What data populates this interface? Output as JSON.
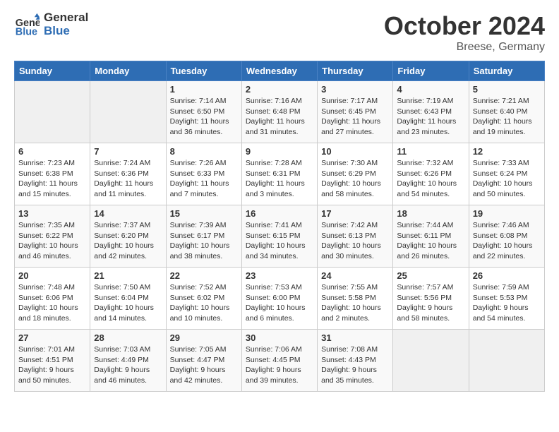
{
  "header": {
    "logo_general": "General",
    "logo_blue": "Blue",
    "month_title": "October 2024",
    "subtitle": "Breese, Germany"
  },
  "weekdays": [
    "Sunday",
    "Monday",
    "Tuesday",
    "Wednesday",
    "Thursday",
    "Friday",
    "Saturday"
  ],
  "days": [
    {
      "date": "",
      "info": ""
    },
    {
      "date": "",
      "info": ""
    },
    {
      "date": "1",
      "info": "Sunrise: 7:14 AM\nSunset: 6:50 PM\nDaylight: 11 hours and 36 minutes."
    },
    {
      "date": "2",
      "info": "Sunrise: 7:16 AM\nSunset: 6:48 PM\nDaylight: 11 hours and 31 minutes."
    },
    {
      "date": "3",
      "info": "Sunrise: 7:17 AM\nSunset: 6:45 PM\nDaylight: 11 hours and 27 minutes."
    },
    {
      "date": "4",
      "info": "Sunrise: 7:19 AM\nSunset: 6:43 PM\nDaylight: 11 hours and 23 minutes."
    },
    {
      "date": "5",
      "info": "Sunrise: 7:21 AM\nSunset: 6:40 PM\nDaylight: 11 hours and 19 minutes."
    },
    {
      "date": "6",
      "info": "Sunrise: 7:23 AM\nSunset: 6:38 PM\nDaylight: 11 hours and 15 minutes."
    },
    {
      "date": "7",
      "info": "Sunrise: 7:24 AM\nSunset: 6:36 PM\nDaylight: 11 hours and 11 minutes."
    },
    {
      "date": "8",
      "info": "Sunrise: 7:26 AM\nSunset: 6:33 PM\nDaylight: 11 hours and 7 minutes."
    },
    {
      "date": "9",
      "info": "Sunrise: 7:28 AM\nSunset: 6:31 PM\nDaylight: 11 hours and 3 minutes."
    },
    {
      "date": "10",
      "info": "Sunrise: 7:30 AM\nSunset: 6:29 PM\nDaylight: 10 hours and 58 minutes."
    },
    {
      "date": "11",
      "info": "Sunrise: 7:32 AM\nSunset: 6:26 PM\nDaylight: 10 hours and 54 minutes."
    },
    {
      "date": "12",
      "info": "Sunrise: 7:33 AM\nSunset: 6:24 PM\nDaylight: 10 hours and 50 minutes."
    },
    {
      "date": "13",
      "info": "Sunrise: 7:35 AM\nSunset: 6:22 PM\nDaylight: 10 hours and 46 minutes."
    },
    {
      "date": "14",
      "info": "Sunrise: 7:37 AM\nSunset: 6:20 PM\nDaylight: 10 hours and 42 minutes."
    },
    {
      "date": "15",
      "info": "Sunrise: 7:39 AM\nSunset: 6:17 PM\nDaylight: 10 hours and 38 minutes."
    },
    {
      "date": "16",
      "info": "Sunrise: 7:41 AM\nSunset: 6:15 PM\nDaylight: 10 hours and 34 minutes."
    },
    {
      "date": "17",
      "info": "Sunrise: 7:42 AM\nSunset: 6:13 PM\nDaylight: 10 hours and 30 minutes."
    },
    {
      "date": "18",
      "info": "Sunrise: 7:44 AM\nSunset: 6:11 PM\nDaylight: 10 hours and 26 minutes."
    },
    {
      "date": "19",
      "info": "Sunrise: 7:46 AM\nSunset: 6:08 PM\nDaylight: 10 hours and 22 minutes."
    },
    {
      "date": "20",
      "info": "Sunrise: 7:48 AM\nSunset: 6:06 PM\nDaylight: 10 hours and 18 minutes."
    },
    {
      "date": "21",
      "info": "Sunrise: 7:50 AM\nSunset: 6:04 PM\nDaylight: 10 hours and 14 minutes."
    },
    {
      "date": "22",
      "info": "Sunrise: 7:52 AM\nSunset: 6:02 PM\nDaylight: 10 hours and 10 minutes."
    },
    {
      "date": "23",
      "info": "Sunrise: 7:53 AM\nSunset: 6:00 PM\nDaylight: 10 hours and 6 minutes."
    },
    {
      "date": "24",
      "info": "Sunrise: 7:55 AM\nSunset: 5:58 PM\nDaylight: 10 hours and 2 minutes."
    },
    {
      "date": "25",
      "info": "Sunrise: 7:57 AM\nSunset: 5:56 PM\nDaylight: 9 hours and 58 minutes."
    },
    {
      "date": "26",
      "info": "Sunrise: 7:59 AM\nSunset: 5:53 PM\nDaylight: 9 hours and 54 minutes."
    },
    {
      "date": "27",
      "info": "Sunrise: 7:01 AM\nSunset: 4:51 PM\nDaylight: 9 hours and 50 minutes."
    },
    {
      "date": "28",
      "info": "Sunrise: 7:03 AM\nSunset: 4:49 PM\nDaylight: 9 hours and 46 minutes."
    },
    {
      "date": "29",
      "info": "Sunrise: 7:05 AM\nSunset: 4:47 PM\nDaylight: 9 hours and 42 minutes."
    },
    {
      "date": "30",
      "info": "Sunrise: 7:06 AM\nSunset: 4:45 PM\nDaylight: 9 hours and 39 minutes."
    },
    {
      "date": "31",
      "info": "Sunrise: 7:08 AM\nSunset: 4:43 PM\nDaylight: 9 hours and 35 minutes."
    },
    {
      "date": "",
      "info": ""
    },
    {
      "date": "",
      "info": ""
    }
  ]
}
